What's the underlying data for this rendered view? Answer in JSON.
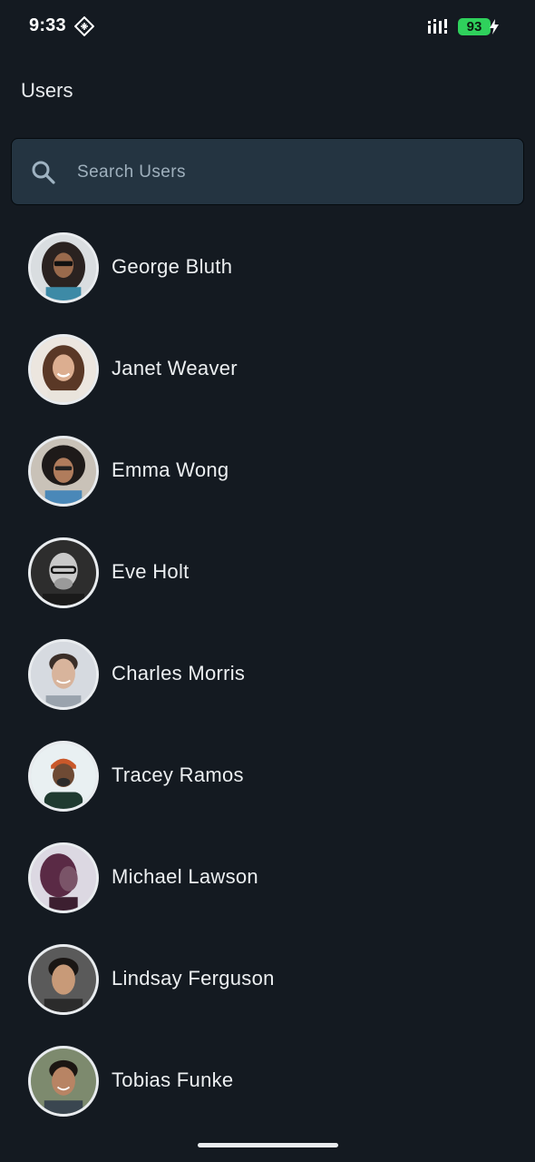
{
  "status_bar": {
    "time": "9:33",
    "battery_level": "93",
    "app_indicator_icon": "diamond-grid-icon",
    "signal_icon": "signal-bars-icon",
    "charging_icon": "bolt-icon"
  },
  "header": {
    "title": "Users"
  },
  "search": {
    "placeholder": "Search Users",
    "value": "",
    "icon": "search-icon"
  },
  "users": [
    {
      "name": "George Bluth"
    },
    {
      "name": "Janet Weaver"
    },
    {
      "name": "Emma Wong"
    },
    {
      "name": "Eve Holt"
    },
    {
      "name": "Charles Morris"
    },
    {
      "name": "Tracey Ramos"
    },
    {
      "name": "Michael Lawson"
    },
    {
      "name": "Lindsay Ferguson"
    },
    {
      "name": "Tobias Funke"
    }
  ],
  "colors": {
    "background": "#141a21",
    "search_background": "#243441",
    "battery": "#2fd15c",
    "text": "#eceff1",
    "placeholder": "#9fb0bd"
  }
}
